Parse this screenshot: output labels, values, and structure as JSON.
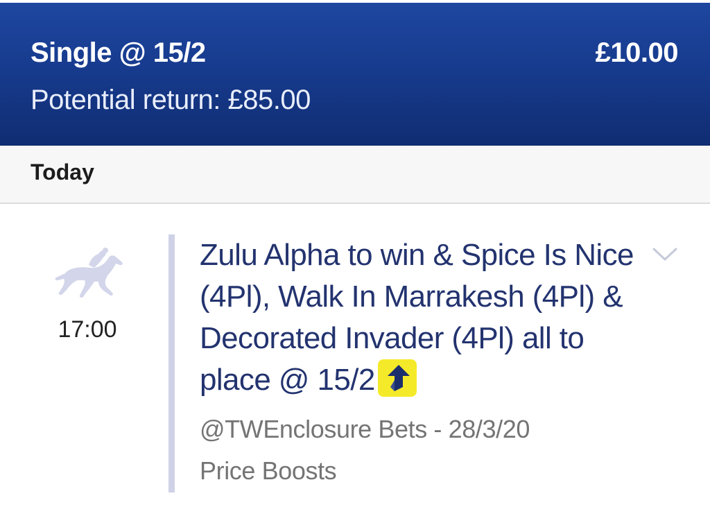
{
  "header": {
    "bet_type": "Single @ 15/2",
    "stake": "£10.00",
    "potential_return": "Potential return: £85.00"
  },
  "date_strip": {
    "label": "Today"
  },
  "selection": {
    "sport_icon": "horse-racing-icon",
    "time": "17:00",
    "description": "Zulu Alpha to win & Spice Is Nice (4Pl), Walk In Marrakesh (4Pl) & Decorated Invader (4Pl) all to place @ 15/2",
    "boost_icon": "price-boost-arrow-icon",
    "source": "@TWEnclosure Bets - 28/3/20",
    "category": "Price Boosts",
    "expand_icon": "chevron-down-icon"
  },
  "colors": {
    "header_bg": "#173b8e",
    "selection_text": "#23336f",
    "boost_badge": "#f5ea2a",
    "divider": "#cfd2e6"
  }
}
